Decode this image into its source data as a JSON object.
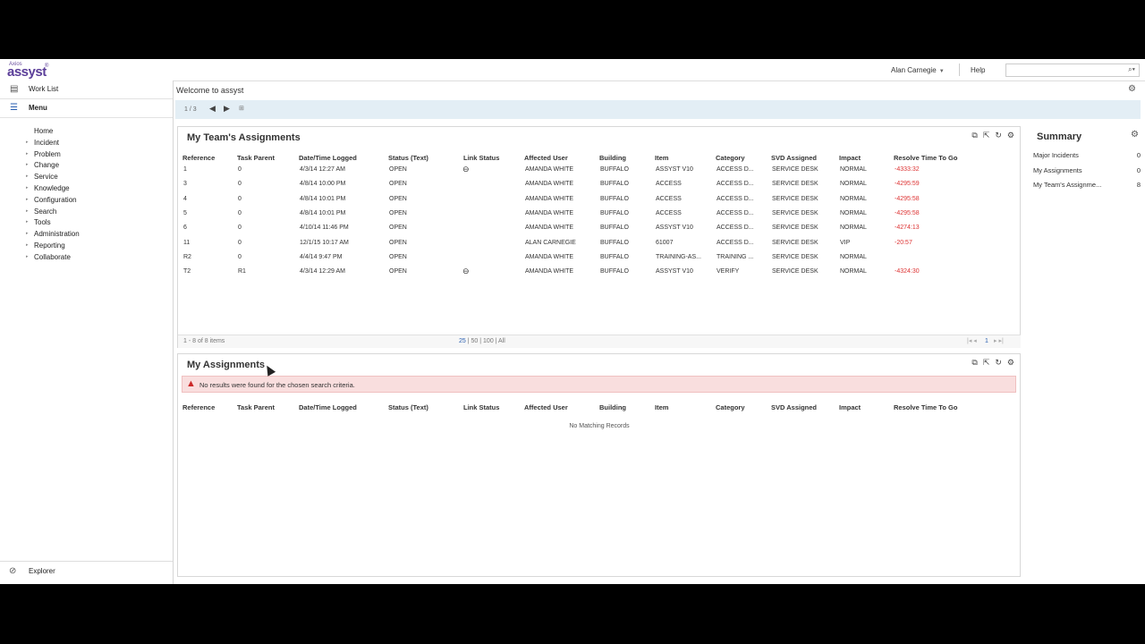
{
  "header": {
    "logo_small": "Axios",
    "logo_big": "assyst",
    "logo_mark": "®",
    "user_name": "Alan Carnegie",
    "help_label": "Help",
    "search_placeholder": ""
  },
  "sidebar": {
    "worklist_label": "Work List",
    "menu_label": "Menu",
    "items": [
      {
        "label": "Home",
        "expandable": false
      },
      {
        "label": "Incident",
        "expandable": true
      },
      {
        "label": "Problem",
        "expandable": true
      },
      {
        "label": "Change",
        "expandable": true
      },
      {
        "label": "Service",
        "expandable": true
      },
      {
        "label": "Knowledge",
        "expandable": true
      },
      {
        "label": "Configuration",
        "expandable": true
      },
      {
        "label": "Search",
        "expandable": true
      },
      {
        "label": "Tools",
        "expandable": true
      },
      {
        "label": "Administration",
        "expandable": true
      },
      {
        "label": "Reporting",
        "expandable": true
      },
      {
        "label": "Collaborate",
        "expandable": true
      }
    ],
    "explorer_label": "Explorer"
  },
  "main": {
    "welcome": "Welcome to assyst",
    "pager": "1 / 3"
  },
  "columns": [
    "Reference",
    "Task Parent",
    "Date/Time Logged",
    "Status (Text)",
    "Link Status",
    "Affected User",
    "Building",
    "Item",
    "Category",
    "SVD Assigned",
    "Impact",
    "Resolve Time To Go"
  ],
  "team_panel": {
    "title": "My Team's Assignments",
    "rows": [
      {
        "ref": "1",
        "parent": "0",
        "logged": "4/3/14 12:27 AM",
        "status": "OPEN",
        "link": true,
        "user": "AMANDA WHITE",
        "building": "BUFFALO",
        "item": "ASSYST V10",
        "category": "ACCESS D...",
        "svd": "SERVICE DESK",
        "impact": "NORMAL",
        "resolve": "-4333:32"
      },
      {
        "ref": "3",
        "parent": "0",
        "logged": "4/8/14 10:00 PM",
        "status": "OPEN",
        "link": false,
        "user": "AMANDA WHITE",
        "building": "BUFFALO",
        "item": "ACCESS",
        "category": "ACCESS D...",
        "svd": "SERVICE DESK",
        "impact": "NORMAL",
        "resolve": "-4295:59"
      },
      {
        "ref": "4",
        "parent": "0",
        "logged": "4/8/14 10:01 PM",
        "status": "OPEN",
        "link": false,
        "user": "AMANDA WHITE",
        "building": "BUFFALO",
        "item": "ACCESS",
        "category": "ACCESS D...",
        "svd": "SERVICE DESK",
        "impact": "NORMAL",
        "resolve": "-4295:58"
      },
      {
        "ref": "5",
        "parent": "0",
        "logged": "4/8/14 10:01 PM",
        "status": "OPEN",
        "link": false,
        "user": "AMANDA WHITE",
        "building": "BUFFALO",
        "item": "ACCESS",
        "category": "ACCESS D...",
        "svd": "SERVICE DESK",
        "impact": "NORMAL",
        "resolve": "-4295:58"
      },
      {
        "ref": "6",
        "parent": "0",
        "logged": "4/10/14 11:46 PM",
        "status": "OPEN",
        "link": false,
        "user": "AMANDA WHITE",
        "building": "BUFFALO",
        "item": "ASSYST V10",
        "category": "ACCESS D...",
        "svd": "SERVICE DESK",
        "impact": "NORMAL",
        "resolve": "-4274:13"
      },
      {
        "ref": "11",
        "parent": "0",
        "logged": "12/1/15 10:17 AM",
        "status": "OPEN",
        "link": false,
        "user": "ALAN CARNEGIE",
        "building": "BUFFALO",
        "item": "61007",
        "category": "ACCESS D...",
        "svd": "SERVICE DESK",
        "impact": "VIP",
        "resolve": "-20:57"
      },
      {
        "ref": "R2",
        "parent": "0",
        "logged": "4/4/14 9:47 PM",
        "status": "OPEN",
        "link": false,
        "user": "AMANDA WHITE",
        "building": "BUFFALO",
        "item": "TRAINING-AS...",
        "category": "TRAINING ...",
        "svd": "SERVICE DESK",
        "impact": "NORMAL",
        "resolve": ""
      },
      {
        "ref": "T2",
        "parent": "R1",
        "logged": "4/3/14 12:29 AM",
        "status": "OPEN",
        "link": true,
        "user": "AMANDA WHITE",
        "building": "BUFFALO",
        "item": "ASSYST V10",
        "category": "VERIFY",
        "svd": "SERVICE DESK",
        "impact": "NORMAL",
        "resolve": "-4324:30"
      }
    ],
    "footer_count": "1 - 8 of 8 items",
    "page_sizes": [
      "25",
      "50",
      "100",
      "All"
    ],
    "current_page": "1"
  },
  "my_panel": {
    "title": "My Assignments",
    "alert": "No results were found for the chosen search criteria.",
    "no_records": "No Matching Records"
  },
  "summary": {
    "title": "Summary",
    "rows": [
      {
        "label": "Major Incidents",
        "count": "0"
      },
      {
        "label": "My Assignments",
        "count": "0"
      },
      {
        "label": "My Team's Assignme...",
        "count": "8"
      }
    ]
  },
  "colors": {
    "accent": "#5b3e99",
    "alert_bg": "#f9dede",
    "overdue": "#dd3333",
    "pager_bg": "#e3eef5"
  }
}
